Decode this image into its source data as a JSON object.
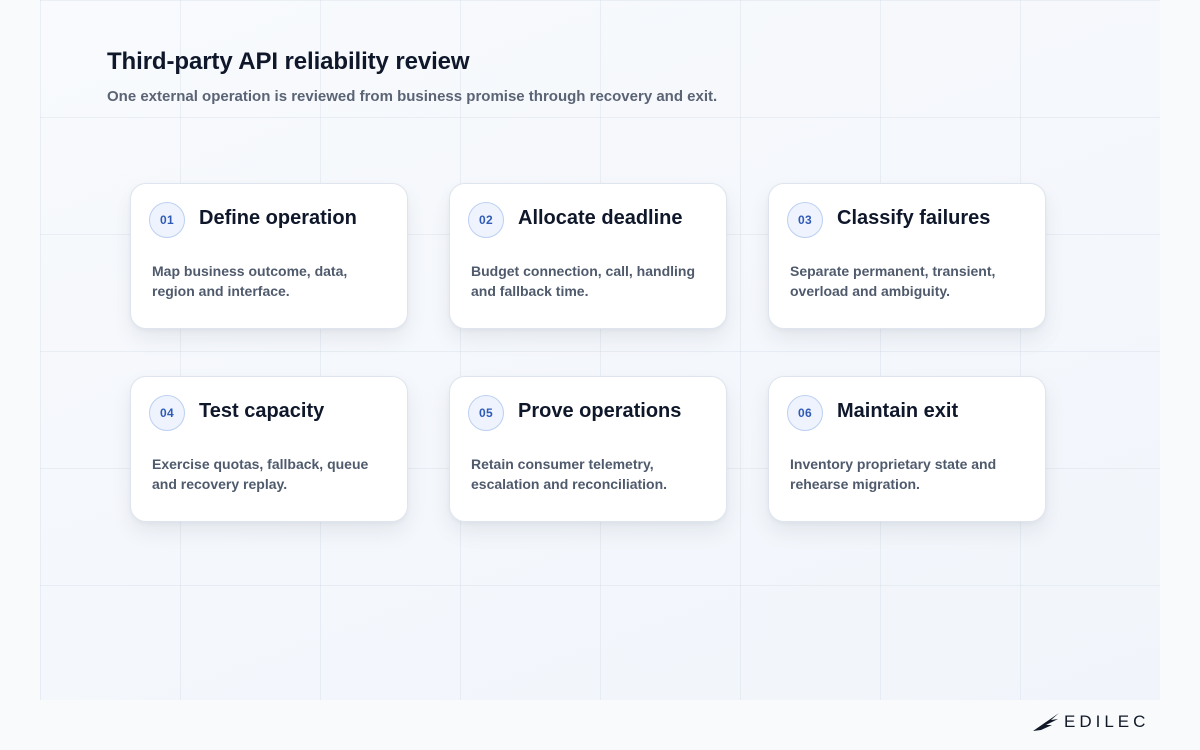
{
  "header": {
    "title": "Third-party API reliability review",
    "subtitle": "One external operation is reviewed from business promise through recovery and exit."
  },
  "steps": [
    {
      "number": "01",
      "title": "Define operation",
      "description": "Map business outcome, data, region and interface."
    },
    {
      "number": "02",
      "title": "Allocate deadline",
      "description": "Budget connection, call, handling and fallback time."
    },
    {
      "number": "03",
      "title": "Classify failures",
      "description": "Separate permanent, transient, overload and ambiguity."
    },
    {
      "number": "04",
      "title": "Test capacity",
      "description": "Exercise quotas, fallback, queue and recovery replay."
    },
    {
      "number": "05",
      "title": "Prove operations",
      "description": "Retain consumer telemetry, escalation and reconciliation."
    },
    {
      "number": "06",
      "title": "Maintain exit",
      "description": "Inventory proprietary state and rehearse migration."
    }
  ],
  "brand": {
    "name": "EDILEC",
    "icon": "bird-wing-logo-icon"
  },
  "colors": {
    "accent": "#2f5bb7",
    "badge_fill": "#eef3fd",
    "badge_border": "#bcd0f2",
    "title_text": "#0f172a",
    "body_text": "#4f5a6c"
  }
}
